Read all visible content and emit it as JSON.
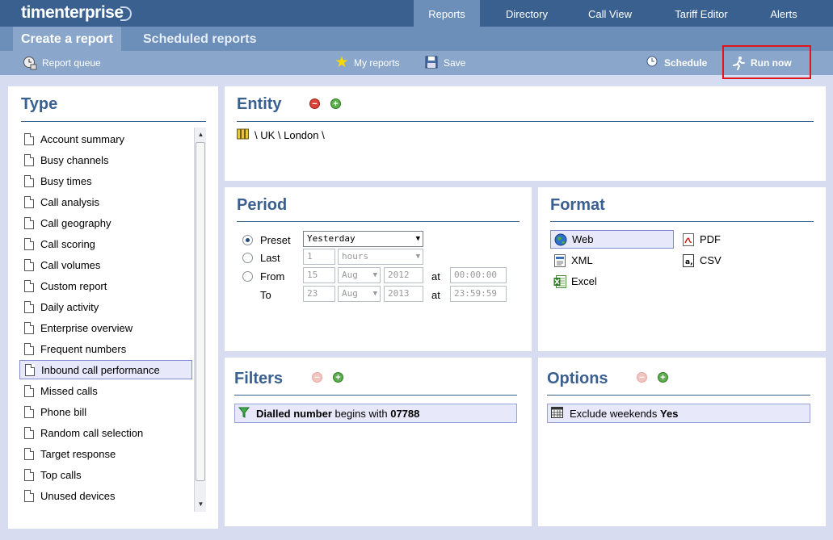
{
  "brand": {
    "name": "timenterprise"
  },
  "nav": {
    "tabs": [
      {
        "label": "Reports",
        "active": true
      },
      {
        "label": "Directory",
        "active": false
      },
      {
        "label": "Call View",
        "active": false
      },
      {
        "label": "Tariff Editor",
        "active": false
      },
      {
        "label": "Alerts",
        "active": false
      }
    ]
  },
  "subnav": {
    "tabs": [
      {
        "label": "Create a report",
        "active": true
      },
      {
        "label": "Scheduled reports",
        "active": false
      }
    ]
  },
  "toolbar": {
    "report_queue": "Report queue",
    "my_reports": "My reports",
    "save": "Save",
    "schedule": "Schedule",
    "run_now": "Run now"
  },
  "type_panel": {
    "title": "Type",
    "items": [
      "Account summary",
      "Busy channels",
      "Busy times",
      "Call analysis",
      "Call geography",
      "Call scoring",
      "Call volumes",
      "Custom report",
      "Daily activity",
      "Enterprise overview",
      "Frequent numbers",
      "Inbound call performance",
      "Missed calls",
      "Phone bill",
      "Random call selection",
      "Target response",
      "Top calls",
      "Unused devices"
    ],
    "selected": "Inbound call performance"
  },
  "entity_panel": {
    "title": "Entity",
    "path": "\\ UK \\ London \\"
  },
  "period_panel": {
    "title": "Period",
    "selected_mode": "Preset",
    "preset_label": "Preset",
    "preset_value": "Yesterday",
    "last_label": "Last",
    "last_count": "1",
    "last_unit": "hours",
    "from_label": "From",
    "to_label": "To",
    "at_label": "at",
    "from": {
      "day": "15",
      "month": "Aug",
      "year": "2012",
      "time": "00:00:00"
    },
    "to": {
      "day": "23",
      "month": "Aug",
      "year": "2013",
      "time": "23:59:59"
    }
  },
  "format_panel": {
    "title": "Format",
    "options": [
      "Web",
      "PDF",
      "XML",
      "CSV",
      "Excel"
    ],
    "selected": "Web"
  },
  "filters_panel": {
    "title": "Filters",
    "rows": [
      {
        "field": "Dialled number",
        "op": "begins with",
        "value": "07788"
      }
    ]
  },
  "options_panel": {
    "title": "Options",
    "rows": [
      {
        "name": "Exclude weekends",
        "value": "Yes"
      }
    ]
  },
  "colors": {
    "nav": "#39608f",
    "subnav": "#6b8fb9",
    "toolbar": "#8aa7cb",
    "accent": "#e0141b",
    "background": "#d7dcf0"
  }
}
